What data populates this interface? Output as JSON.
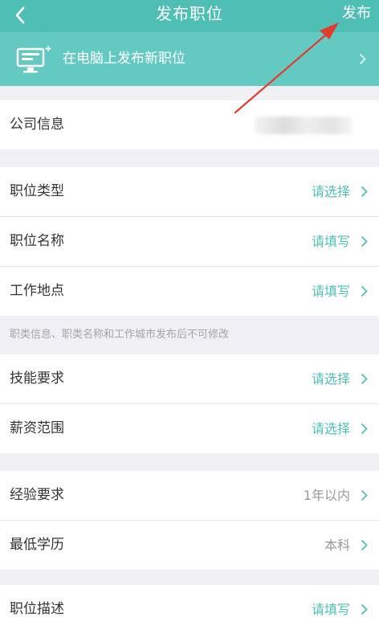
{
  "header": {
    "title": "发布职位",
    "publish_label": "发布"
  },
  "banner": {
    "text": "在电脑上发布新职位"
  },
  "company": {
    "label": "公司信息",
    "value": ""
  },
  "job_basic": [
    {
      "label": "职位类型",
      "value": "请选择"
    },
    {
      "label": "职位名称",
      "value": "请填写"
    },
    {
      "label": "工作地点",
      "value": "请填写"
    }
  ],
  "note": "职类信息、职类名称和工作城市发布后不可修改",
  "requirements": [
    {
      "label": "技能要求",
      "value": "请选择"
    },
    {
      "label": "薪资范围",
      "value": "请选择"
    }
  ],
  "experience": [
    {
      "label": "经验要求",
      "value": "1年以内"
    },
    {
      "label": "最低学历",
      "value": "本科"
    }
  ],
  "description": {
    "label": "职位描述",
    "value": "请填写"
  },
  "colors": {
    "accent": "#4fbfb5",
    "banner": "#64c9c1",
    "annotation_arrow": "#e23c2e"
  }
}
